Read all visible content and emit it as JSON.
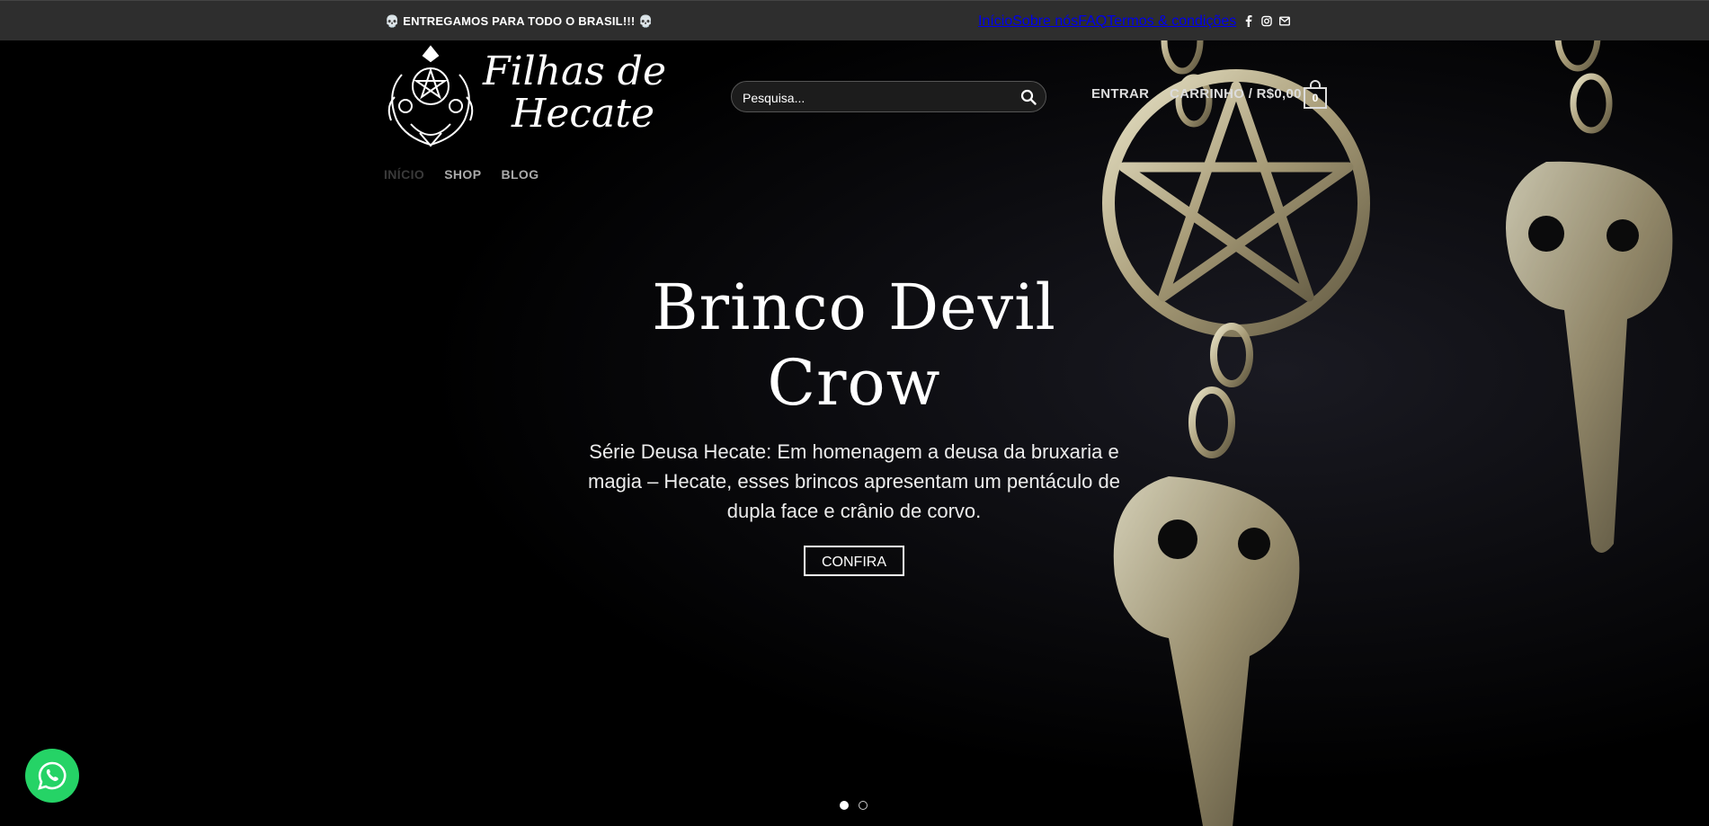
{
  "topbar": {
    "promo": "💀 ENTREGAMOS PARA TODO O BRASIL!!! 💀",
    "nav": [
      "Início",
      "Sobre nós",
      "FAQ",
      "Termos & condições"
    ],
    "social_icons": [
      "facebook-icon",
      "instagram-icon",
      "email-icon"
    ]
  },
  "logo": {
    "line1": "Filhas de",
    "line2": "Hecate"
  },
  "search": {
    "placeholder": "Pesquisa..."
  },
  "header": {
    "login": "ENTRAR",
    "cart_label": "CARRINHO / R$0,00",
    "cart_count": "0"
  },
  "mainnav": [
    "INÍCIO",
    "SHOP",
    "BLOG"
  ],
  "hero": {
    "title": "Brinco Devil Crow",
    "description": "Série Deusa Hecate: Em homenagem a deusa da bruxaria e magia – Hecate, esses brincos apresentam um pentáculo de dupla face e crânio de corvo.",
    "cta": "CONFIRA"
  },
  "slider": {
    "current": 1,
    "total": 2
  },
  "colors": {
    "accent": "#6a1bc6",
    "topbar": "#2e2e2e",
    "whatsapp": "#25d366"
  }
}
